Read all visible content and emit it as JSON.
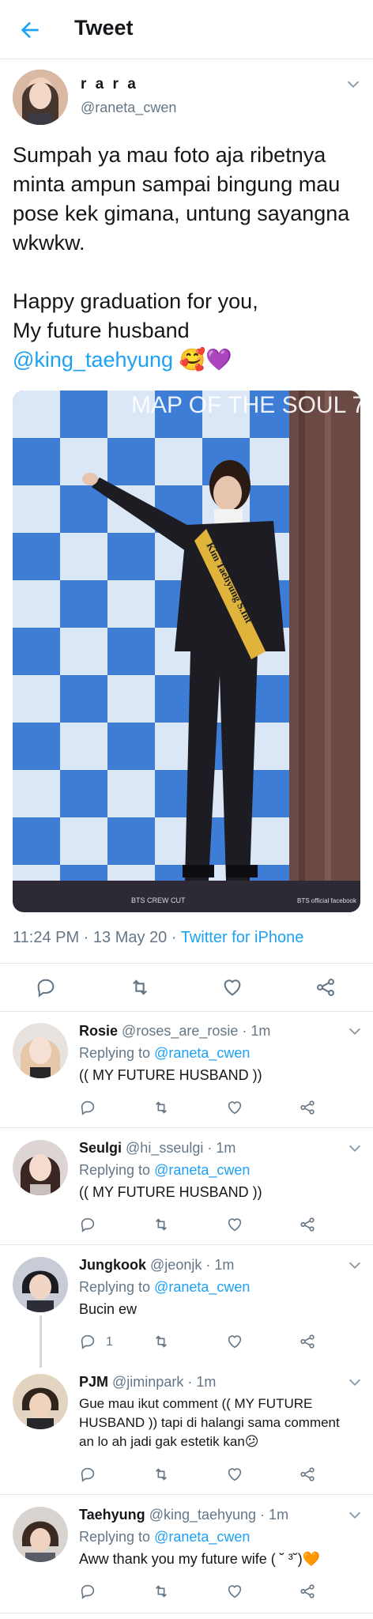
{
  "header": {
    "title": "Tweet"
  },
  "main_tweet": {
    "name": "r a r a",
    "handle": "@raneta_cwen",
    "text_lines": [
      "Sumpah ya mau foto aja ribetnya minta ampun sampai bingung mau pose kek gimana, untung sayangna wkwkw.",
      "Happy graduation for you,",
      "My future husband"
    ],
    "mention": "@king_taehyung",
    "emoji": "🥰💜",
    "photo": {
      "banner_text": "MAP OF THE SOUL 7",
      "sash_text": "Kim Taehyung S.Int",
      "caption": "BTS CREW CUT",
      "watermark": "BTS official facebook"
    },
    "timestamp": "11:24 PM · 13 May 20 · ",
    "source": "Twitter for iPhone"
  },
  "replies": [
    {
      "name": "Rosie",
      "handle": "@roses_are_rosie · 1m",
      "replying_label": "Replying to ",
      "replying_to": "@raneta_cwen",
      "text": "(( MY FUTURE HUSBAND ))",
      "reply_count": ""
    },
    {
      "name": "Seulgi",
      "handle": "@hi_sseulgi · 1m",
      "replying_label": "Replying to ",
      "replying_to": "@raneta_cwen",
      "text": "(( MY FUTURE HUSBAND ))",
      "reply_count": ""
    },
    {
      "name": "Jungkook",
      "handle": "@jeonjk · 1m",
      "replying_label": "Replying to ",
      "replying_to": "@raneta_cwen",
      "text": "Bucin ew",
      "reply_count": "1"
    },
    {
      "name": "PJM",
      "handle": "@jiminpark · 1m",
      "text": "Gue mau ikut comment (( MY FUTURE HUSBAND )) tapi di halangi sama comment an lo ah jadi gak estetik kan😕"
    },
    {
      "name": "Taehyung",
      "handle": "@king_taehyung · 1m",
      "replying_label": "Replying to ",
      "replying_to": "@raneta_cwen",
      "text": "Aww thank you my future wife ( ˘ ³˘)🧡"
    }
  ],
  "colors": {
    "accent": "#1da1f2",
    "text": "#14171a",
    "secondary": "#657786",
    "divider": "#e1e8ed"
  }
}
